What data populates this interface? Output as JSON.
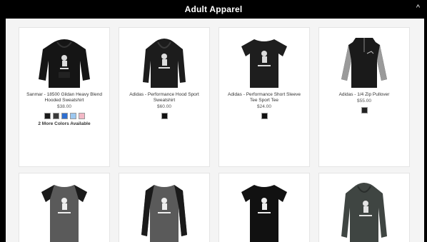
{
  "header": {
    "title": "Adult Apparel",
    "collapse_icon": "chevron-up-icon",
    "collapse_glyph": "^"
  },
  "products": [
    {
      "title": "Sanmar - 18500 Gildan Heavy Blend Hooded Sweatshirt",
      "price": "$38.00",
      "swatches": [
        "#1a1a1a",
        "#3a3a3a",
        "#2e6fd1",
        "#9cc8f0",
        "#f2b8c6"
      ],
      "more_colors": "2 More Colors Available",
      "image": "black-hoodie"
    },
    {
      "title": "Adidas - Performance Hood Sport Sweatshirt",
      "price": "$60.00",
      "swatches": [
        "#111111"
      ],
      "more_colors": "",
      "image": "black-hoodie-sport"
    },
    {
      "title": "Adidas - Performance Short Sleeve Tee Sport Tee",
      "price": "$24.00",
      "swatches": [
        "#111111"
      ],
      "more_colors": "",
      "image": "black-tee"
    },
    {
      "title": "Adidas - 1/4 Zip Pullover",
      "price": "$55.00",
      "swatches": [
        "#222222"
      ],
      "more_colors": "",
      "image": "gray-quarter-zip"
    },
    {
      "title": "",
      "price": "",
      "swatches": [],
      "more_colors": "",
      "image": "gray-raglan-tee"
    },
    {
      "title": "",
      "price": "",
      "swatches": [],
      "more_colors": "",
      "image": "gray-raglan-long"
    },
    {
      "title": "",
      "price": "",
      "swatches": [],
      "more_colors": "",
      "image": "black-tee-2"
    },
    {
      "title": "",
      "price": "",
      "swatches": [],
      "more_colors": "",
      "image": "gray-hoodie"
    }
  ],
  "colors": {
    "header_bg": "#000000",
    "header_text": "#ffffff",
    "panel_bg": "#f4f4f4"
  }
}
